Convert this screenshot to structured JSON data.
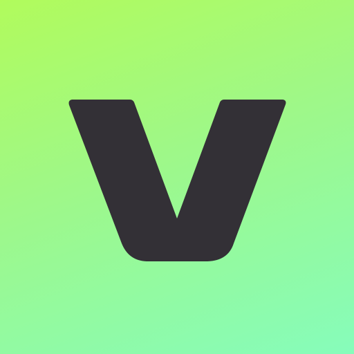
{
  "icon": {
    "name": "v-logo-icon",
    "logo_letter": "V",
    "colors": {
      "gradient_start": "#b1fb5c",
      "gradient_mid": "#9ef889",
      "gradient_end": "#86fcbb",
      "glyph": "#333036"
    }
  }
}
